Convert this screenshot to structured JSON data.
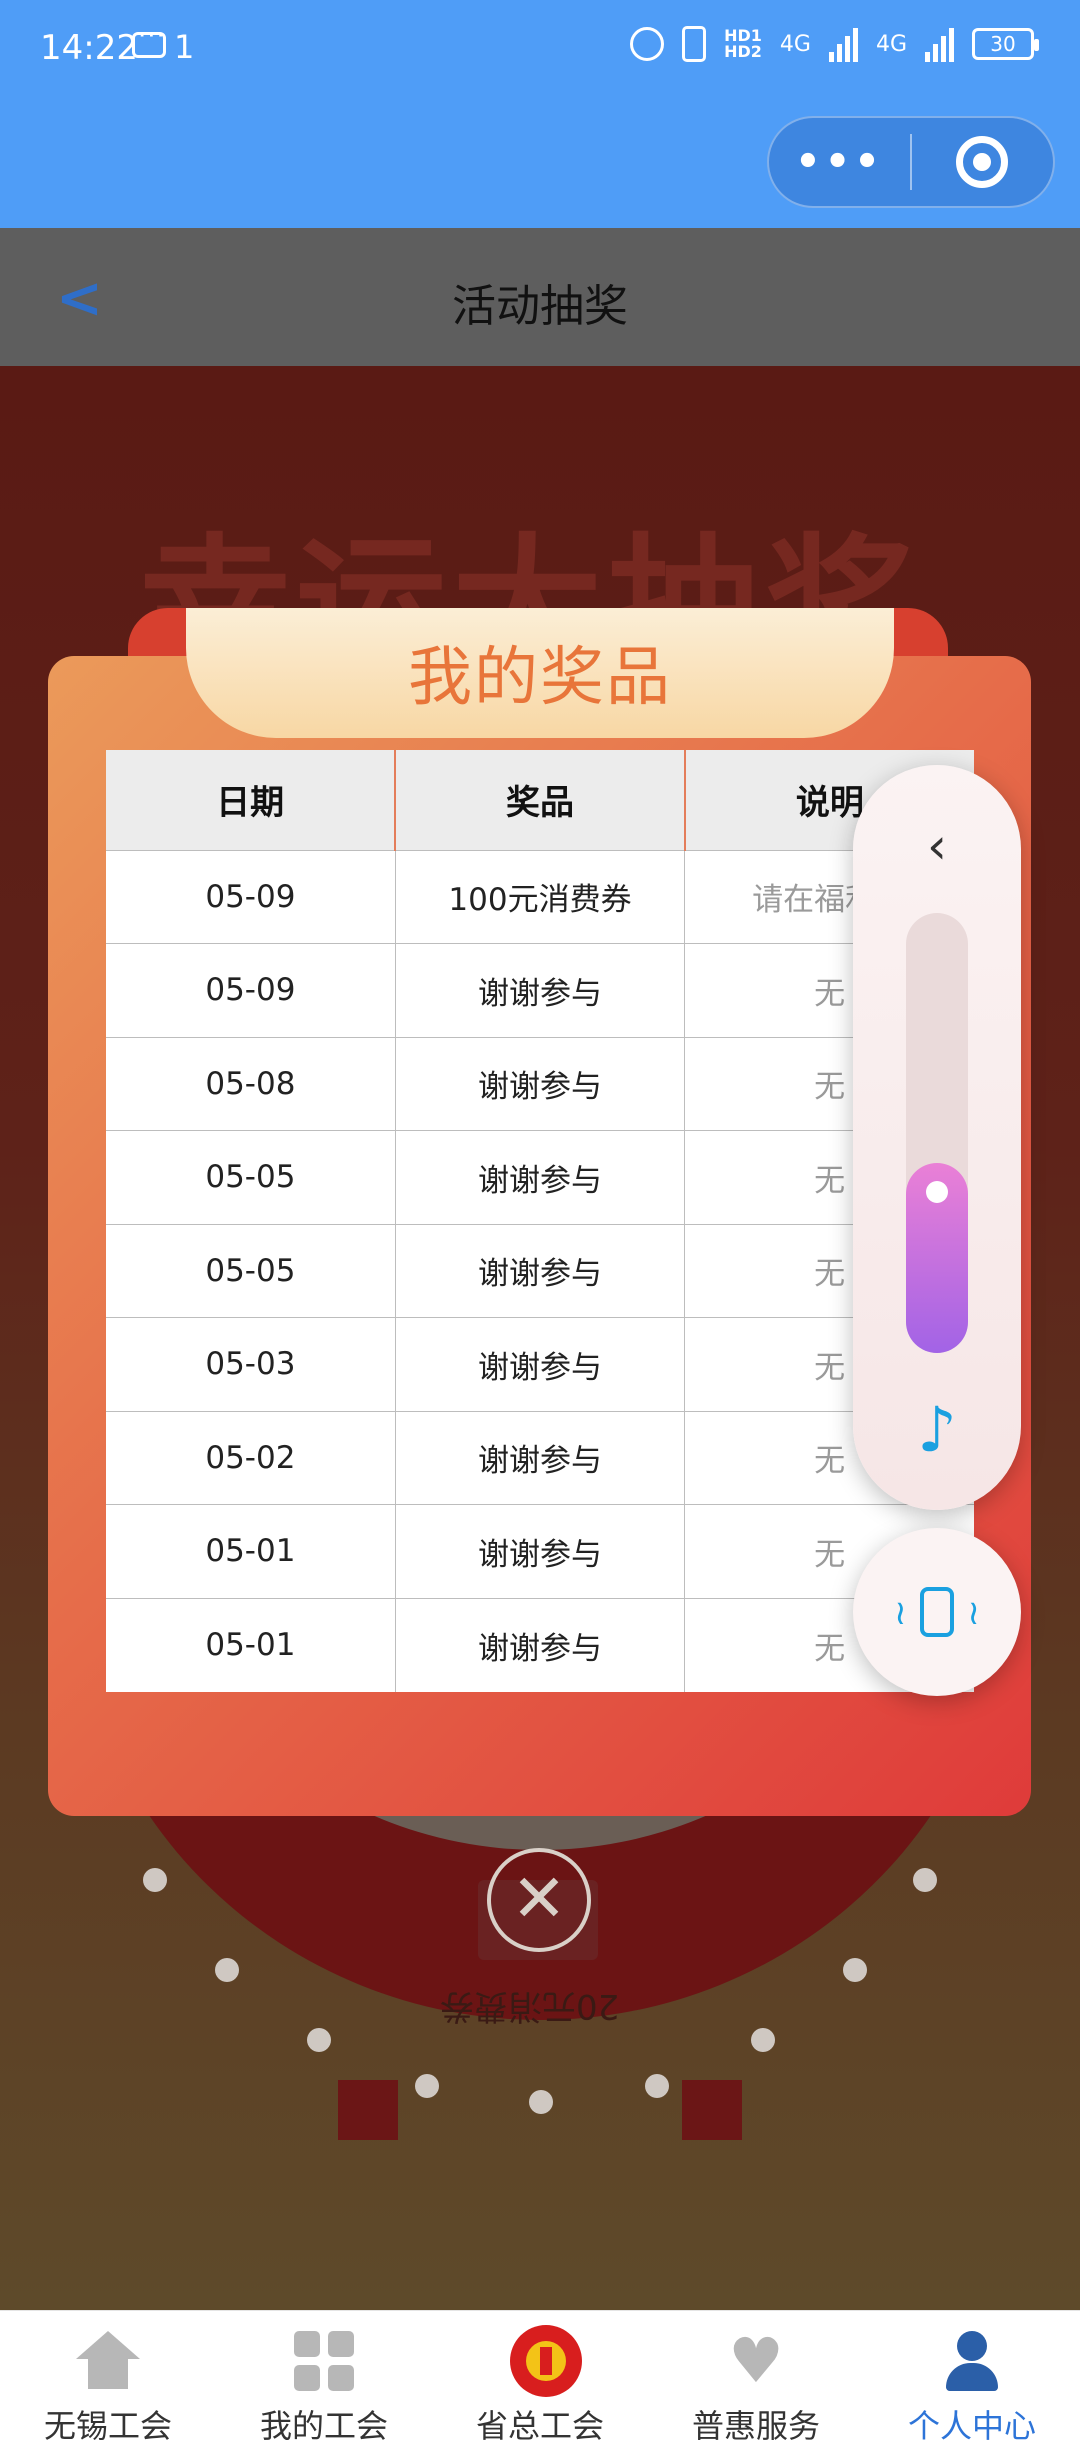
{
  "status_bar": {
    "time": "14:22",
    "message_count": "1",
    "hd_labels": [
      "HD1",
      "HD2"
    ],
    "network": [
      "4G",
      "4G"
    ],
    "battery": "30"
  },
  "capsule": {
    "more_icon": "more-dots-icon",
    "close_icon": "target-icon"
  },
  "navbar": {
    "back_icon": "chevron-left-icon",
    "title": "活动抽奖"
  },
  "background": {
    "banner_title": "幸运大抽奖",
    "wheel_prize_label": "20元消费券"
  },
  "modal": {
    "title": "我的奖品",
    "columns": [
      "日期",
      "奖品",
      "说明"
    ],
    "rows": [
      {
        "date": "05-09",
        "prize": "100元消费券",
        "note": "请在福利中"
      },
      {
        "date": "05-09",
        "prize": "谢谢参与",
        "note": "无"
      },
      {
        "date": "05-08",
        "prize": "谢谢参与",
        "note": "无"
      },
      {
        "date": "05-05",
        "prize": "谢谢参与",
        "note": "无"
      },
      {
        "date": "05-05",
        "prize": "谢谢参与",
        "note": "无"
      },
      {
        "date": "05-03",
        "prize": "谢谢参与",
        "note": "无"
      },
      {
        "date": "05-02",
        "prize": "谢谢参与",
        "note": "无"
      },
      {
        "date": "05-01",
        "prize": "谢谢参与",
        "note": "无"
      },
      {
        "date": "05-01",
        "prize": "谢谢参与",
        "note": "无"
      }
    ],
    "close_glyph": "✕"
  },
  "float_panel": {
    "collapse_glyph": "‹",
    "volume_level": 0.32,
    "music_glyph": "♪"
  },
  "tabbar": {
    "items": [
      {
        "label": "无锡工会",
        "icon": "home-icon",
        "active": false
      },
      {
        "label": "我的工会",
        "icon": "grid-icon",
        "active": false
      },
      {
        "label": "省总工会",
        "icon": "union-emblem-icon",
        "active": false
      },
      {
        "label": "普惠服务",
        "icon": "heart-icon",
        "active": false
      },
      {
        "label": "个人中心",
        "icon": "user-icon",
        "active": true
      }
    ],
    "active_color": "#2d74d8"
  },
  "colors": {
    "brand_blue": "#4f9df7",
    "modal_orange": "#e66d4a",
    "modal_title": "#e8753a"
  }
}
